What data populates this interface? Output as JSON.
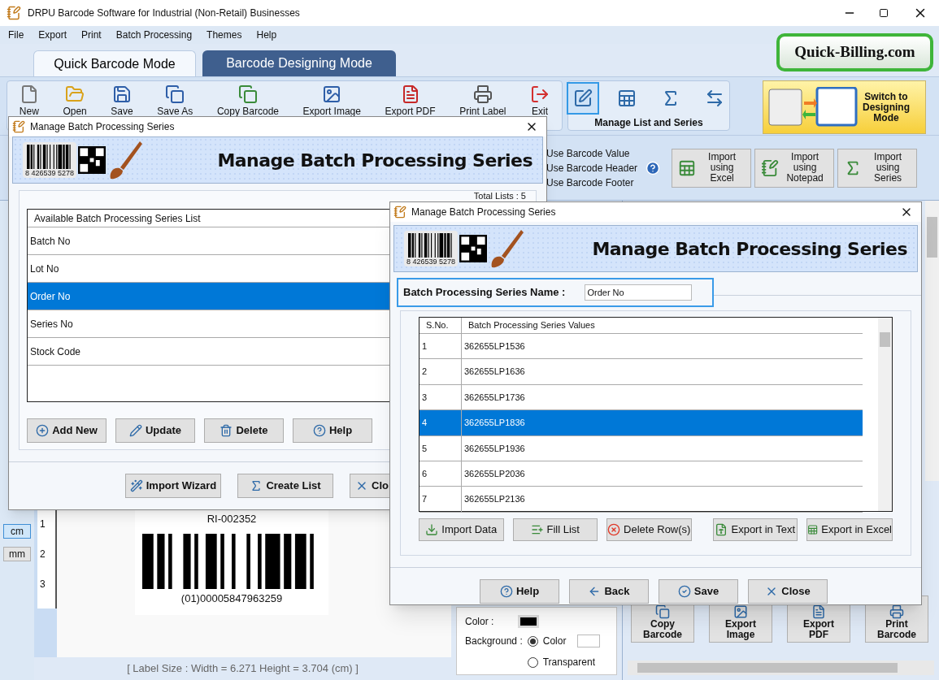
{
  "window": {
    "title": "DRPU Barcode Software for Industrial (Non-Retail) Businesses"
  },
  "menu": [
    "File",
    "Export",
    "Print",
    "Batch Processing",
    "Themes",
    "Help"
  ],
  "mode_tabs": [
    {
      "label": "Quick Barcode Mode",
      "selected": true
    },
    {
      "label": "Barcode Designing Mode",
      "selected": false
    }
  ],
  "logo": "Quick-Billing.com",
  "toolbar": [
    "New",
    "Open",
    "Save",
    "Save As",
    "Copy Barcode",
    "Export Image",
    "Export PDF",
    "Print Label",
    "Exit"
  ],
  "manage_group": {
    "title": "Manage List and Series",
    "tools": [
      {
        "selected": true
      },
      {
        "selected": false
      },
      {
        "selected": false
      },
      {
        "selected": false
      }
    ]
  },
  "switch_button": {
    "lines": [
      "Switch to",
      "Designing",
      "Mode"
    ]
  },
  "barcode_options": [
    "Use Barcode Value",
    "Use Barcode Header",
    "Use Barcode Footer"
  ],
  "import_buttons": [
    "Import using Excel",
    "Import using Notepad",
    "Import using Series"
  ],
  "units": [
    {
      "label": "cm",
      "selected": true
    },
    {
      "label": "mm",
      "selected": false
    }
  ],
  "ruler": [
    "1",
    "2",
    "3"
  ],
  "label": {
    "header": "RI-002352",
    "footer": "(01)00005847963259"
  },
  "status": "[ Label Size : Width = 6.271  Height = 3.704 (cm) ]",
  "color_panel": {
    "color_label": "Color :",
    "background_label": "Background :",
    "options": [
      {
        "label": "Color",
        "selected": true
      },
      {
        "label": "Transparent",
        "selected": false
      }
    ]
  },
  "action_buttons": [
    "Copy Barcode",
    "Export Image",
    "Export PDF",
    "Print Barcode"
  ],
  "list_dialog": {
    "title": "Manage Batch Processing Series",
    "banner": "Manage Batch Processing Series",
    "banner_code": "8 426539 5278",
    "total": "Total Lists : 5",
    "list_header": "Available Batch Processing Series List",
    "items": [
      {
        "label": "Batch No",
        "selected": false
      },
      {
        "label": "Lot No",
        "selected": false
      },
      {
        "label": "Order No",
        "selected": true
      },
      {
        "label": "Series No",
        "selected": false
      },
      {
        "label": "Stock Code",
        "selected": false
      }
    ],
    "buttons": [
      "Add New",
      "Update",
      "Delete",
      "Help"
    ],
    "footer_buttons": [
      "Import Wizard",
      "Create List",
      "Clo"
    ]
  },
  "series_dialog": {
    "title": "Manage Batch Processing Series",
    "banner": "Manage Batch Processing Series",
    "banner_code": "8 426539 5278",
    "name_label": "Batch Processing Series Name :",
    "name_value": "Order No",
    "columns": [
      "S.No.",
      "Batch Processing Series Values"
    ],
    "rows": [
      {
        "sno": "1",
        "value": "362655LP1536",
        "selected": false
      },
      {
        "sno": "2",
        "value": "362655LP1636",
        "selected": false
      },
      {
        "sno": "3",
        "value": "362655LP1736",
        "selected": false
      },
      {
        "sno": "4",
        "value": "362655LP1836",
        "selected": true
      },
      {
        "sno": "5",
        "value": "362655LP1936",
        "selected": false
      },
      {
        "sno": "6",
        "value": "362655LP2036",
        "selected": false
      },
      {
        "sno": "7",
        "value": "362655LP2136",
        "selected": false
      }
    ],
    "tools": [
      "Import Data",
      "Fill List",
      "Delete Row(s)",
      "Export in Text",
      "Export in Excel"
    ],
    "buttons": [
      "Help",
      "Back",
      "Save",
      "Close"
    ]
  }
}
